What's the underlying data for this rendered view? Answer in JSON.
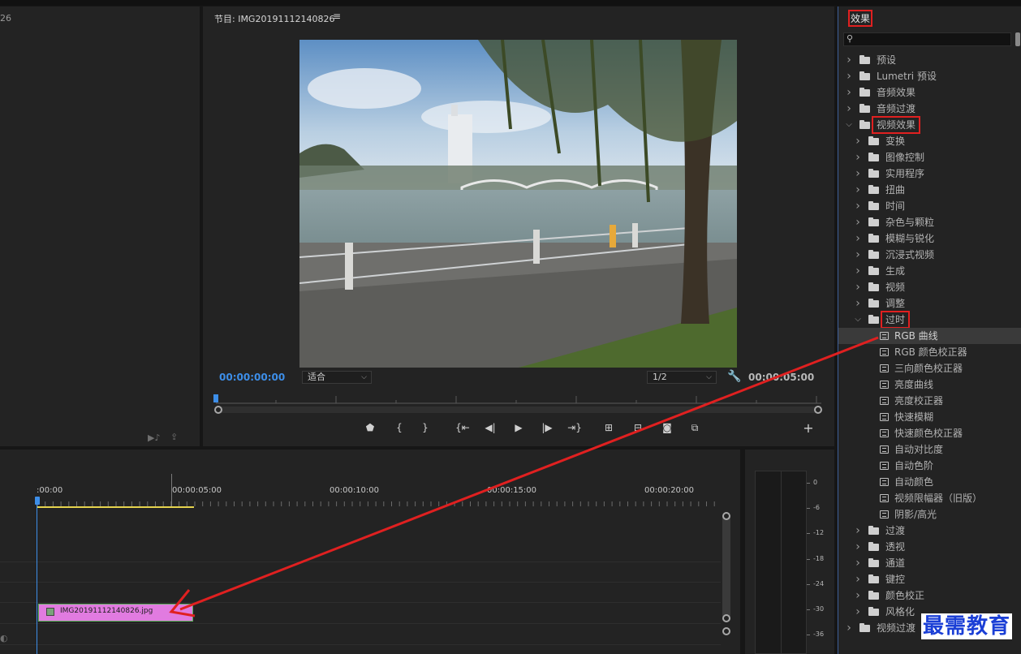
{
  "source": {
    "timecode_fragment": "26"
  },
  "program": {
    "title": "节目: IMG20191112140826",
    "menu_icon": "≡",
    "current_time": "00:00:00:00",
    "fit_label": "适合",
    "resolution_label": "1/2",
    "duration": "00:00:05:00"
  },
  "effects": {
    "title": "效果",
    "search_placeholder": "",
    "tree": [
      {
        "label": "预设",
        "level": 0,
        "kind": "folder-star",
        "expanded": false
      },
      {
        "label": "Lumetri 预设",
        "level": 0,
        "kind": "folder-star",
        "expanded": false
      },
      {
        "label": "音频效果",
        "level": 0,
        "kind": "folder",
        "expanded": false
      },
      {
        "label": "音频过渡",
        "level": 0,
        "kind": "folder",
        "expanded": false
      },
      {
        "label": "视频效果",
        "level": 0,
        "kind": "folder",
        "expanded": true,
        "highlight": true
      },
      {
        "label": "变换",
        "level": 1,
        "kind": "folder",
        "expanded": false
      },
      {
        "label": "图像控制",
        "level": 1,
        "kind": "folder",
        "expanded": false
      },
      {
        "label": "实用程序",
        "level": 1,
        "kind": "folder",
        "expanded": false
      },
      {
        "label": "扭曲",
        "level": 1,
        "kind": "folder",
        "expanded": false
      },
      {
        "label": "时间",
        "level": 1,
        "kind": "folder",
        "expanded": false
      },
      {
        "label": "杂色与颗粒",
        "level": 1,
        "kind": "folder",
        "expanded": false
      },
      {
        "label": "模糊与锐化",
        "level": 1,
        "kind": "folder",
        "expanded": false
      },
      {
        "label": "沉浸式视频",
        "level": 1,
        "kind": "folder",
        "expanded": false
      },
      {
        "label": "生成",
        "level": 1,
        "kind": "folder",
        "expanded": false
      },
      {
        "label": "视频",
        "level": 1,
        "kind": "folder",
        "expanded": false
      },
      {
        "label": "调整",
        "level": 1,
        "kind": "folder",
        "expanded": false
      },
      {
        "label": "过时",
        "level": 1,
        "kind": "folder",
        "expanded": true,
        "highlight": true
      },
      {
        "label": "RGB 曲线",
        "level": 2,
        "kind": "effect",
        "selected": true
      },
      {
        "label": "RGB 颜色校正器",
        "level": 2,
        "kind": "effect"
      },
      {
        "label": "三向颜色校正器",
        "level": 2,
        "kind": "effect"
      },
      {
        "label": "亮度曲线",
        "level": 2,
        "kind": "effect"
      },
      {
        "label": "亮度校正器",
        "level": 2,
        "kind": "effect"
      },
      {
        "label": "快速模糊",
        "level": 2,
        "kind": "effect"
      },
      {
        "label": "快速颜色校正器",
        "level": 2,
        "kind": "effect"
      },
      {
        "label": "自动对比度",
        "level": 2,
        "kind": "effect"
      },
      {
        "label": "自动色阶",
        "level": 2,
        "kind": "effect"
      },
      {
        "label": "自动颜色",
        "level": 2,
        "kind": "effect"
      },
      {
        "label": "视频限幅器（旧版）",
        "level": 2,
        "kind": "effect"
      },
      {
        "label": "阴影/高光",
        "level": 2,
        "kind": "effect"
      },
      {
        "label": "过渡",
        "level": 1,
        "kind": "folder",
        "expanded": false
      },
      {
        "label": "透视",
        "level": 1,
        "kind": "folder",
        "expanded": false
      },
      {
        "label": "通道",
        "level": 1,
        "kind": "folder",
        "expanded": false
      },
      {
        "label": "键控",
        "level": 1,
        "kind": "folder",
        "expanded": false
      },
      {
        "label": "颜色校正",
        "level": 1,
        "kind": "folder",
        "expanded": false
      },
      {
        "label": "风格化",
        "level": 1,
        "kind": "folder",
        "expanded": false
      },
      {
        "label": "视频过渡",
        "level": 0,
        "kind": "folder",
        "expanded": false
      }
    ]
  },
  "timeline": {
    "ruler_labels": [
      ":00:00",
      "00:00:05:00",
      "00:00:10:00",
      "00:00:15:00",
      "00:00:20:00"
    ],
    "clip_name": "IMG20191112140826.jpg"
  },
  "meter": {
    "labels": [
      "0",
      "-6",
      "-12",
      "-18",
      "-24",
      "-30",
      "-36"
    ]
  },
  "watermark": "最需教育",
  "colors": {
    "accent": "#3d8ee8",
    "highlight_box": "#e02020",
    "clip": "#e17be0",
    "work_area": "#e5d34d"
  }
}
